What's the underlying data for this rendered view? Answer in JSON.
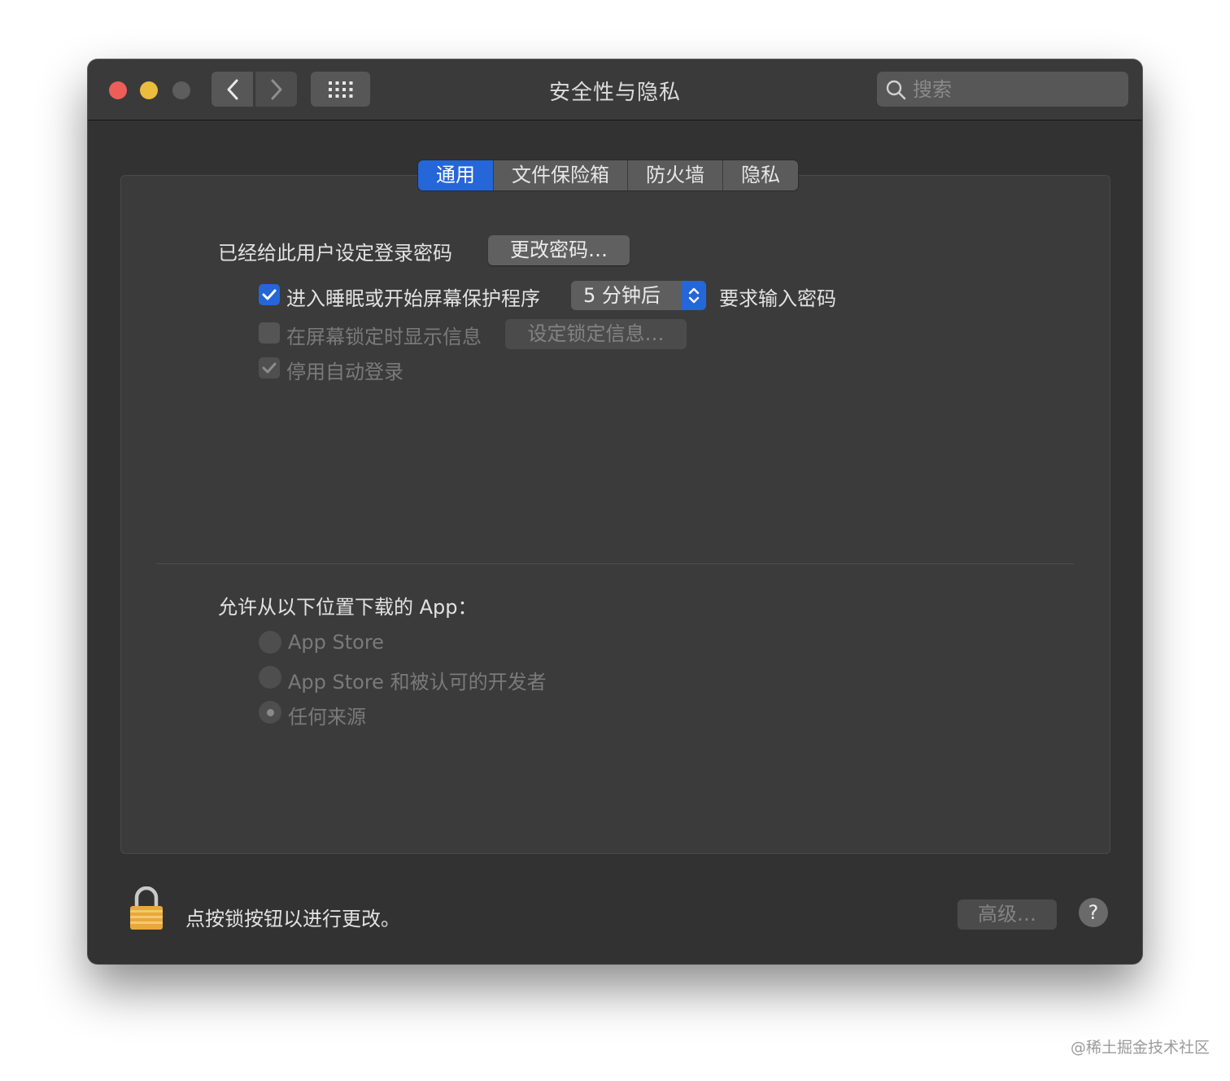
{
  "window": {
    "title": "安全性与隐私"
  },
  "search": {
    "placeholder": "搜索",
    "icon": "magnifier-icon"
  },
  "tabs": [
    {
      "label": "通用",
      "active": true
    },
    {
      "label": "文件保险箱",
      "active": false
    },
    {
      "label": "防火墙",
      "active": false
    },
    {
      "label": "隐私",
      "active": false
    }
  ],
  "general": {
    "password_status": "已经给此用户设定登录密码",
    "change_password_label": "更改密码…",
    "require_password_prefix": "进入睡眠或开始屏幕保护程序",
    "require_password_delay": "5 分钟后",
    "require_password_suffix": "要求输入密码",
    "show_message_label": "在屏幕锁定时显示信息",
    "set_lock_message_label": "设定锁定信息…",
    "disable_auto_login_label": "停用自动登录"
  },
  "downloads": {
    "heading": "允许从以下位置下载的 App：",
    "options": [
      {
        "label": "App Store",
        "selected": false
      },
      {
        "label": "App Store 和被认可的开发者",
        "selected": false
      },
      {
        "label": "任何来源",
        "selected": true
      }
    ]
  },
  "footer": {
    "lock_hint": "点按锁按钮以进行更改。",
    "advanced_label": "高级…",
    "help_label": "?"
  },
  "watermark": "@稀土掘金技术社区",
  "colors": {
    "accent": "#2566d9",
    "window_bg": "#323232"
  }
}
